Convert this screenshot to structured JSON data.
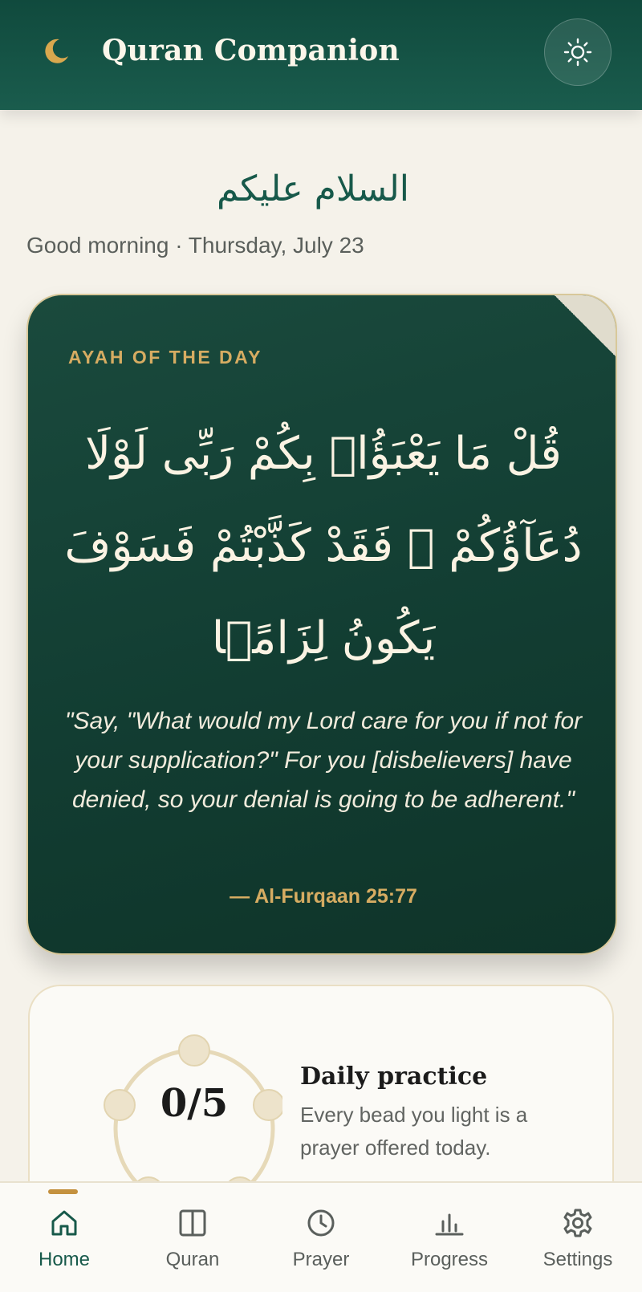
{
  "header": {
    "app_title": "Quran Companion",
    "logo_icon": "crescent-moon-icon",
    "theme_toggle_icon": "sun-icon"
  },
  "greeting": {
    "arabic": "السلام عليكم",
    "text": "Good morning · Thursday, July 23"
  },
  "ayah": {
    "label": "AYAH OF THE DAY",
    "arabic": "قُلْ مَا يَعْبَؤُا۟ بِكُمْ رَبِّى لَوْلَا دُعَآؤُكُمْ ۖ فَقَدْ كَذَّبْتُمْ فَسَوْفَ يَكُونُ لِزَامًۢا",
    "translation": "\"Say, \"What would my Lord care for you if not for your supplication?\" For you [disbelievers] have denied, so your denial is going to be adherent.\"",
    "reference": "— Al-Furqaan 25:77"
  },
  "practice": {
    "count_text": "0/5",
    "completed": 0,
    "total": 5,
    "title": "Daily practice",
    "description": "Every bead you light is a prayer offered today."
  },
  "nav": {
    "active": "Home",
    "items": [
      {
        "label": "Home",
        "icon": "home-icon"
      },
      {
        "label": "Quran",
        "icon": "book-icon"
      },
      {
        "label": "Prayer",
        "icon": "clock-icon"
      },
      {
        "label": "Progress",
        "icon": "bar-chart-icon"
      },
      {
        "label": "Settings",
        "icon": "gear-icon"
      }
    ]
  },
  "colors": {
    "primary": "#17594a",
    "accent_gold": "#d6ac62",
    "background": "#f5f2ea",
    "card_dark": "#123d32"
  }
}
